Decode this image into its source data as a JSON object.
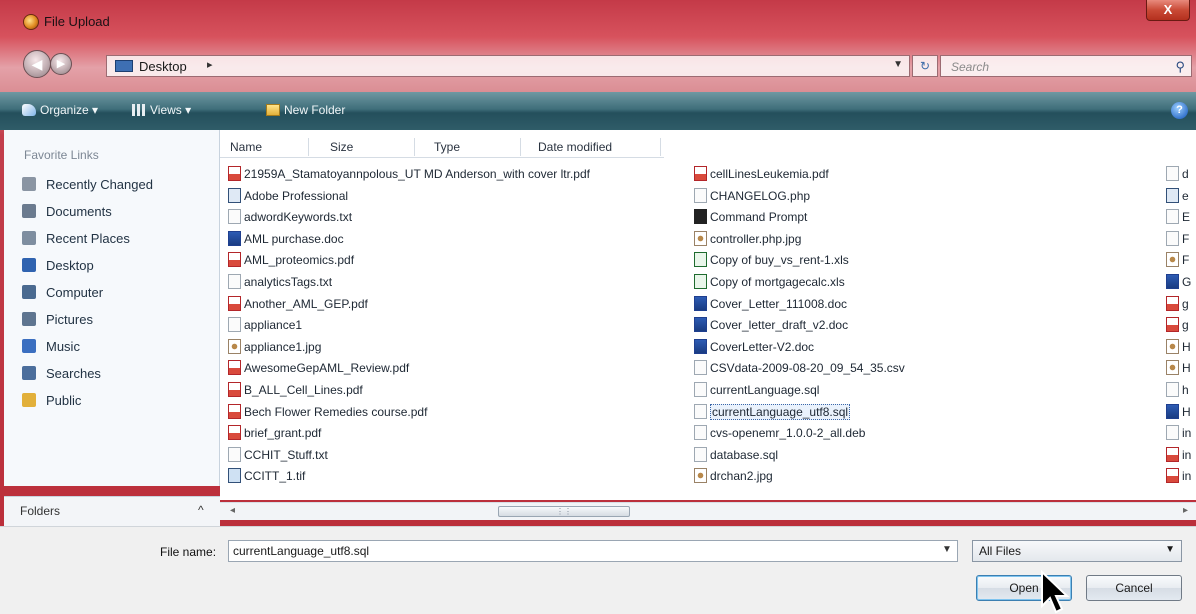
{
  "window": {
    "title": "File Upload",
    "close_glyph": "X"
  },
  "address": {
    "location": "Desktop",
    "separator": "▸",
    "search_placeholder": "Search"
  },
  "toolbar": {
    "organize": "Organize ▾",
    "views": "Views ▾",
    "new_folder": "New Folder",
    "help_glyph": "?"
  },
  "sidebar": {
    "header": "Favorite Links",
    "items": [
      {
        "label": "Recently Changed",
        "icon": "recent-icon",
        "color": "#8a95a3"
      },
      {
        "label": "Documents",
        "icon": "documents-icon",
        "color": "#6b7b8f"
      },
      {
        "label": "Recent Places",
        "icon": "recent-places-icon",
        "color": "#7e8ea0"
      },
      {
        "label": "Desktop",
        "icon": "desktop-icon",
        "color": "#2f63b0"
      },
      {
        "label": "Computer",
        "icon": "computer-icon",
        "color": "#4a6a90"
      },
      {
        "label": "Pictures",
        "icon": "pictures-icon",
        "color": "#5e7590"
      },
      {
        "label": "Music",
        "icon": "music-icon",
        "color": "#3b6fc0"
      },
      {
        "label": "Searches",
        "icon": "searches-icon",
        "color": "#4b6e9c"
      },
      {
        "label": "Public",
        "icon": "public-icon",
        "color": "#e2b03a"
      }
    ],
    "folders_label": "Folders",
    "folders_chevron": "^"
  },
  "columns": [
    "Name",
    "Size",
    "Type",
    "Date modified"
  ],
  "files_col1": [
    {
      "name": "21959A_Stamatoyannpolous_UT MD Anderson_with cover ltr.pdf",
      "type": "pdf"
    },
    {
      "name": "Adobe Professional",
      "type": "app"
    },
    {
      "name": "adwordKeywords.txt",
      "type": "txt"
    },
    {
      "name": "AML purchase.doc",
      "type": "doc"
    },
    {
      "name": "AML_proteomics.pdf",
      "type": "pdf"
    },
    {
      "name": "analyticsTags.txt",
      "type": "txt"
    },
    {
      "name": "Another_AML_GEP.pdf",
      "type": "pdf"
    },
    {
      "name": "appliance1",
      "type": "txt"
    },
    {
      "name": "appliance1.jpg",
      "type": "img"
    },
    {
      "name": "AwesomeGepAML_Review.pdf",
      "type": "pdf"
    },
    {
      "name": "B_ALL_Cell_Lines.pdf",
      "type": "pdf"
    },
    {
      "name": "Bech Flower Remedies course.pdf",
      "type": "pdf"
    },
    {
      "name": "brief_grant.pdf",
      "type": "pdf"
    },
    {
      "name": "CCHIT_Stuff.txt",
      "type": "txt"
    },
    {
      "name": "CCITT_1.tif",
      "type": "tif"
    }
  ],
  "files_col2": [
    {
      "name": "cellLinesLeukemia.pdf",
      "type": "pdf"
    },
    {
      "name": "CHANGELOG.php",
      "type": "txt"
    },
    {
      "name": "Command Prompt",
      "type": "cmd"
    },
    {
      "name": "controller.php.jpg",
      "type": "img"
    },
    {
      "name": "Copy of buy_vs_rent-1.xls",
      "type": "xls"
    },
    {
      "name": "Copy of mortgagecalc.xls",
      "type": "xls"
    },
    {
      "name": "Cover_Letter_111008.doc",
      "type": "doc"
    },
    {
      "name": "Cover_letter_draft_v2.doc",
      "type": "doc"
    },
    {
      "name": "CoverLetter-V2.doc",
      "type": "doc"
    },
    {
      "name": "CSVdata-2009-08-20_09_54_35.csv",
      "type": "txt"
    },
    {
      "name": "currentLanguage.sql",
      "type": "txt"
    },
    {
      "name": "currentLanguage_utf8.sql",
      "type": "txt",
      "selected": true
    },
    {
      "name": "cvs-openemr_1.0.0-2_all.deb",
      "type": "txt"
    },
    {
      "name": "database.sql",
      "type": "txt"
    },
    {
      "name": "drchan2.jpg",
      "type": "img"
    }
  ],
  "files_col3": [
    {
      "name": "d",
      "type": "txt"
    },
    {
      "name": "e",
      "type": "app"
    },
    {
      "name": "E",
      "type": "txt"
    },
    {
      "name": "F",
      "type": "txt"
    },
    {
      "name": "F",
      "type": "img"
    },
    {
      "name": "G",
      "type": "doc"
    },
    {
      "name": "g",
      "type": "pdf"
    },
    {
      "name": "g",
      "type": "pdf"
    },
    {
      "name": "H",
      "type": "img"
    },
    {
      "name": "H",
      "type": "img"
    },
    {
      "name": "h",
      "type": "txt"
    },
    {
      "name": "H",
      "type": "doc"
    },
    {
      "name": "in",
      "type": "txt"
    },
    {
      "name": "in",
      "type": "pdf"
    },
    {
      "name": "in",
      "type": "pdf"
    }
  ],
  "bottom": {
    "file_name_label": "File name:",
    "file_name_value": "currentLanguage_utf8.sql",
    "filter": "All Files",
    "open": "Open",
    "cancel": "Cancel"
  },
  "colors": {
    "accent": "#3c7fb1",
    "window_frame": "#b92b37",
    "toolbar": "#2f5c68"
  }
}
